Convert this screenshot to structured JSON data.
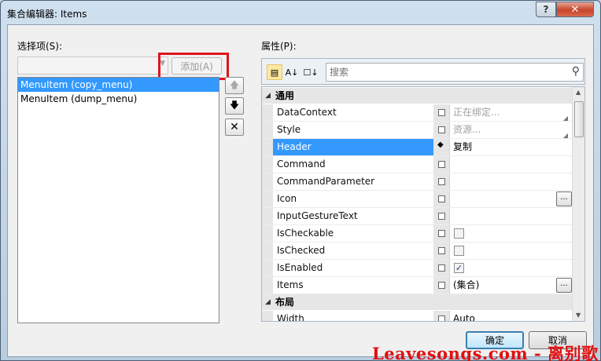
{
  "window": {
    "title": "集合编辑器: Items",
    "help_label": "?",
    "close_label": "✕"
  },
  "left_panel": {
    "select_label": "选择项(S):",
    "combo_value": "",
    "add_button_label": "添加(A)",
    "items": [
      "MenuItem (copy_menu)",
      "MenuItem (dump_menu)"
    ],
    "selected_index": 0
  },
  "side_buttons": {
    "move_up_icon": "arrow-up-icon",
    "move_down_icon": "arrow-down-icon",
    "delete_icon": "delete-x-icon"
  },
  "properties": {
    "label": "属性(P):",
    "search_placeholder": "搜索",
    "categories": [
      {
        "name": "通用",
        "rows": [
          {
            "name": "DataContext",
            "value": "正在绑定...",
            "muted": true,
            "kind": "text"
          },
          {
            "name": "Style",
            "value": "资源...",
            "muted": true,
            "kind": "text"
          },
          {
            "name": "Header",
            "value": "复制",
            "muted": false,
            "kind": "text",
            "selected": true
          },
          {
            "name": "Command",
            "value": "",
            "kind": "text"
          },
          {
            "name": "CommandParameter",
            "value": "",
            "kind": "text"
          },
          {
            "name": "Icon",
            "value": "",
            "kind": "ellipsis"
          },
          {
            "name": "InputGestureText",
            "value": "",
            "kind": "text"
          },
          {
            "name": "IsCheckable",
            "value": "",
            "kind": "checkbox",
            "checked": false
          },
          {
            "name": "IsChecked",
            "value": "",
            "kind": "checkbox",
            "checked": false
          },
          {
            "name": "IsEnabled",
            "value": "",
            "kind": "checkbox",
            "checked": true
          },
          {
            "name": "Items",
            "value": "(集合)",
            "kind": "ellipsis"
          }
        ]
      },
      {
        "name": "布局",
        "rows": [
          {
            "name": "Width",
            "value": "Auto",
            "kind": "text"
          }
        ]
      }
    ]
  },
  "buttons": {
    "ok_label": "确定",
    "cancel_label": "取消"
  },
  "watermark": "Leavesongs.com - 离别歌",
  "colors": {
    "selection": "#3399ff",
    "highlight_box": "#e0141c",
    "watermark": "#e01010"
  }
}
